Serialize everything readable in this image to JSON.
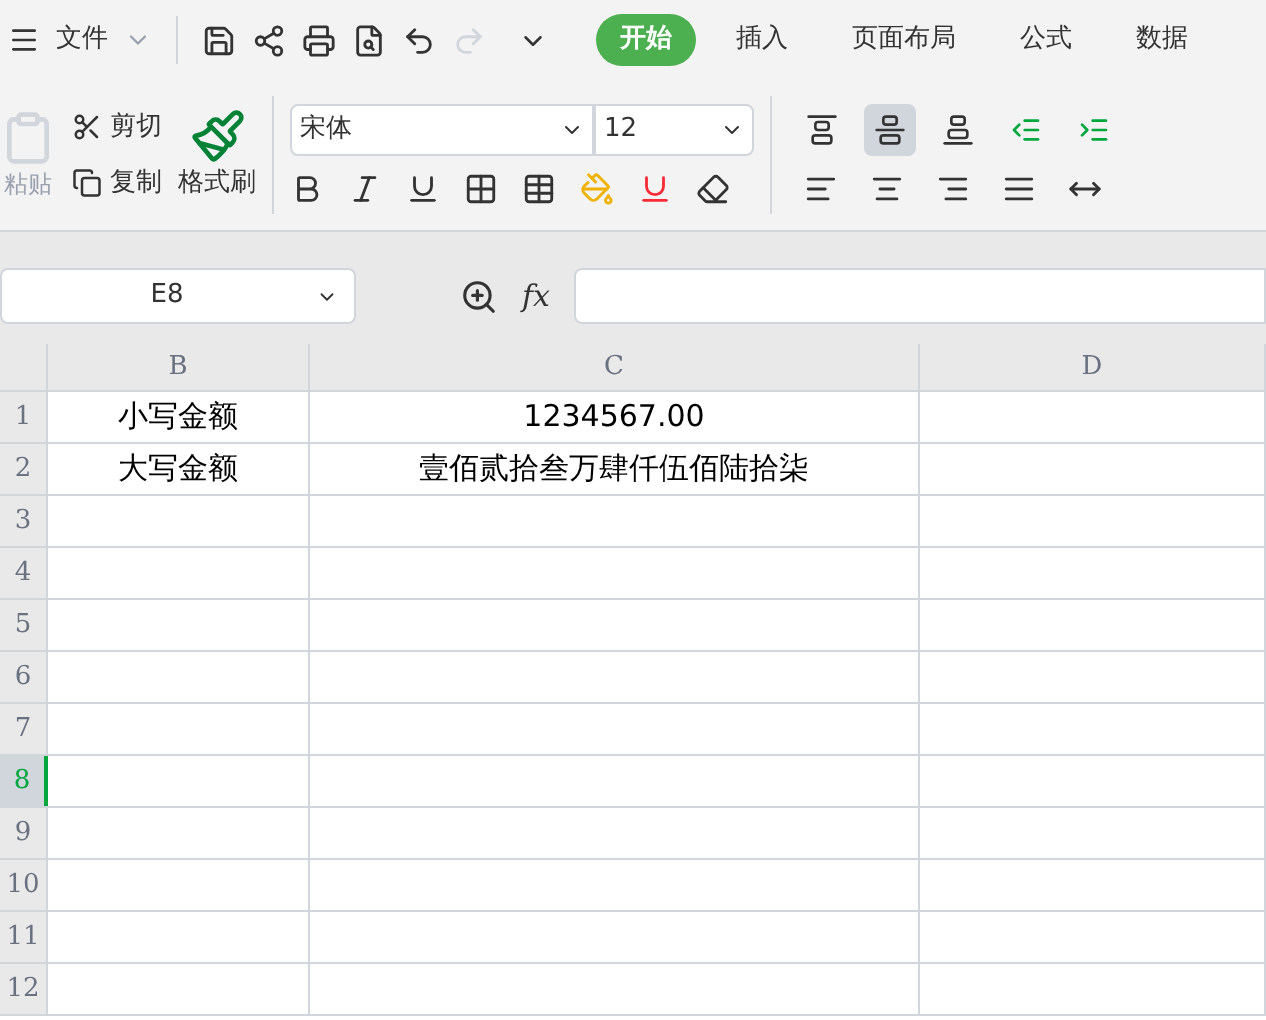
{
  "menu": {
    "file": "文件"
  },
  "tabs": [
    {
      "label": "开始",
      "selected": true
    },
    {
      "label": "插入",
      "selected": false
    },
    {
      "label": "页面布局",
      "selected": false
    },
    {
      "label": "公式",
      "selected": false
    },
    {
      "label": "数据",
      "selected": false
    }
  ],
  "ribbon": {
    "paste": "粘贴",
    "cut": "剪切",
    "copy": "复制",
    "format_painter": "格式刷",
    "font": "宋体",
    "size": "12"
  },
  "align_buttons": [
    {
      "kind": "top",
      "selected": false
    },
    {
      "kind": "middle",
      "selected": true
    },
    {
      "kind": "bottom",
      "selected": false
    },
    {
      "kind": "outdent",
      "selected": false
    },
    {
      "kind": "indent",
      "selected": false
    }
  ],
  "formula_bar": {
    "name_box": "E8",
    "fx": "fx"
  },
  "sheet": {
    "columns": [
      {
        "label": "B",
        "selected": false
      },
      {
        "label": "C",
        "selected": false
      },
      {
        "label": "D",
        "selected": false
      }
    ],
    "rows": [
      {
        "label": "1",
        "selected": false,
        "cells": [
          "小写金额",
          "1234567.00",
          ""
        ]
      },
      {
        "label": "2",
        "selected": false,
        "cells": [
          "大写金额",
          "壹佰贰拾叁万肆仟伍佰陆拾柒",
          ""
        ]
      },
      {
        "label": "3",
        "selected": false,
        "cells": [
          "",
          "",
          ""
        ]
      },
      {
        "label": "4",
        "selected": false,
        "cells": [
          "",
          "",
          ""
        ]
      },
      {
        "label": "5",
        "selected": false,
        "cells": [
          "",
          "",
          ""
        ]
      },
      {
        "label": "6",
        "selected": false,
        "cells": [
          "",
          "",
          ""
        ]
      },
      {
        "label": "7",
        "selected": false,
        "cells": [
          "",
          "",
          ""
        ]
      },
      {
        "label": "8",
        "selected": true,
        "cells": [
          "",
          "",
          ""
        ]
      },
      {
        "label": "9",
        "selected": false,
        "cells": [
          "",
          "",
          ""
        ]
      },
      {
        "label": "10",
        "selected": false,
        "cells": [
          "",
          "",
          ""
        ]
      },
      {
        "label": "11",
        "selected": false,
        "cells": [
          "",
          "",
          ""
        ]
      },
      {
        "label": "12",
        "selected": false,
        "cells": [
          "",
          "",
          ""
        ]
      }
    ]
  }
}
